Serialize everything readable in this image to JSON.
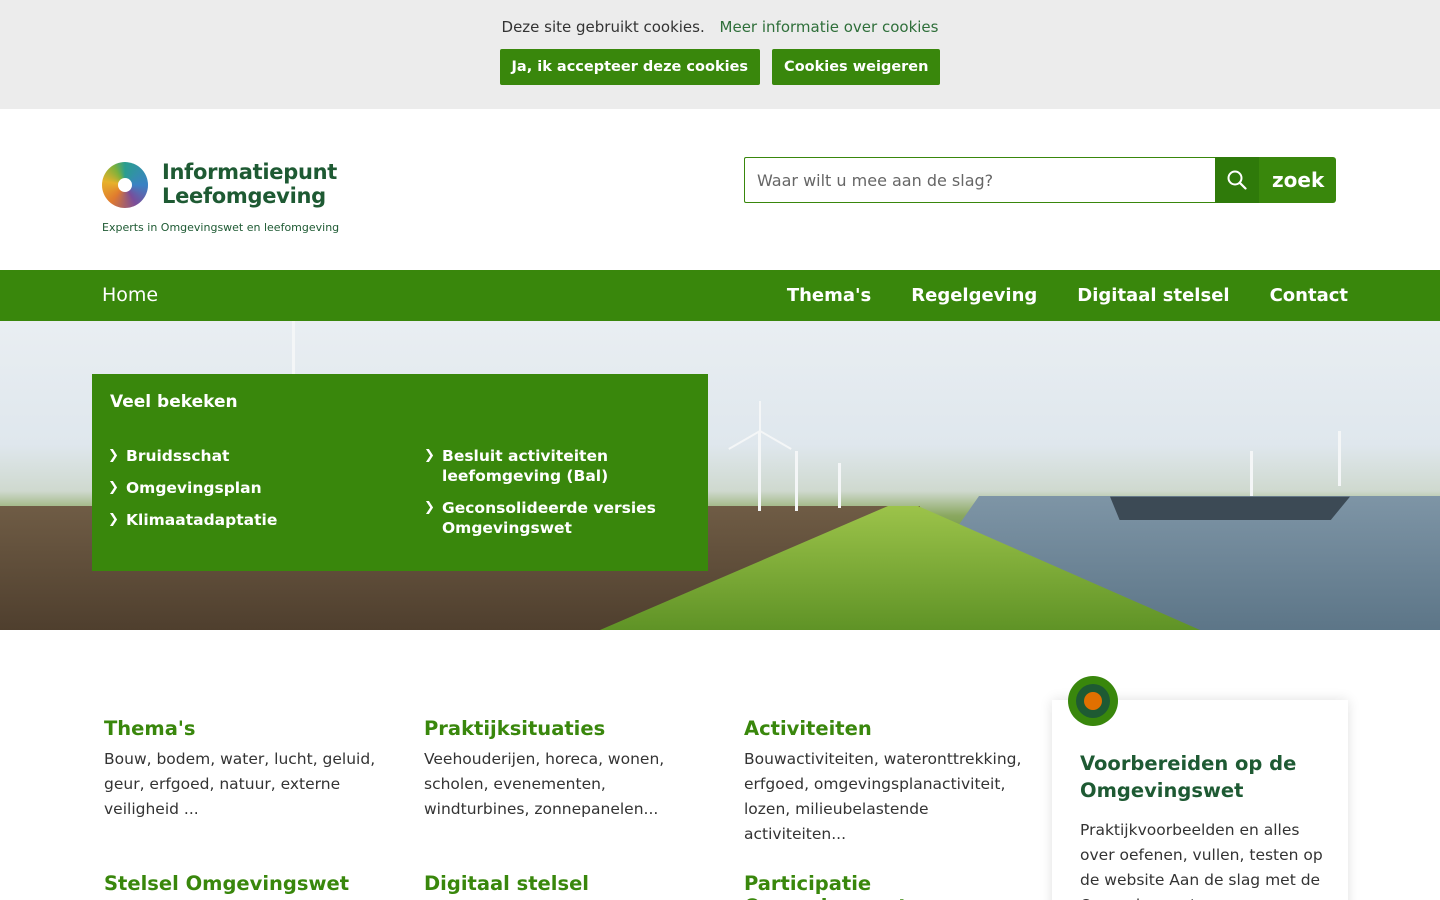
{
  "cookie": {
    "message": "Deze site gebruikt cookies.",
    "more_link": "Meer informatie over cookies",
    "accept_label": "Ja, ik accepteer deze cookies",
    "decline_label": "Cookies weigeren"
  },
  "logo": {
    "line1": "Informatiepunt",
    "line2": "Leefomgeving",
    "tagline": "Experts in Omgevingswet en leefomgeving"
  },
  "search": {
    "placeholder": "Waar wilt u mee aan de slag?",
    "button_label": "zoek",
    "icon": "search-icon"
  },
  "nav": {
    "home": "Home",
    "items": [
      "Thema's",
      "Regelgeving",
      "Digitaal stelsel",
      "Contact"
    ]
  },
  "panel": {
    "title": "Veel bekeken",
    "col1": [
      "Bruidsschat",
      "Omgevingsplan",
      "Klimaatadaptatie"
    ],
    "col2": [
      "Besluit activiteiten leefomgeving (Bal)",
      "Geconsolideerde versies Omgevingswet"
    ]
  },
  "tiles": [
    {
      "title": "Thema's",
      "text": "Bouw, bodem, water, lucht, geluid, geur, erfgoed, natuur, externe veiligheid ..."
    },
    {
      "title": "Praktijksituaties",
      "text": "Veehouderijen, horeca, wonen, scholen, evenementen, windturbines, zonnepanelen..."
    },
    {
      "title": "Activiteiten",
      "text": "Bouwactiviteiten, wateronttrekking, erfgoed, omgevingsplanactiviteit, lozen, milieubelastende activiteiten..."
    },
    {
      "title": "Stelsel Omgevingswet",
      "text": ""
    },
    {
      "title": "Digitaal stelsel",
      "text": ""
    },
    {
      "title": "Participatie Omgevingswet",
      "text": ""
    }
  ],
  "card": {
    "title": "Voorbereiden op de Omgevingswet",
    "text": "Praktijkvoorbeelden en alles over oefenen, vullen, testen op de website Aan de slag met de Omgevingswet"
  },
  "colors": {
    "brand_green": "#39870c",
    "dark_green": "#1e5a33",
    "accent_orange": "#e17000",
    "cookie_bg": "#ececec"
  }
}
